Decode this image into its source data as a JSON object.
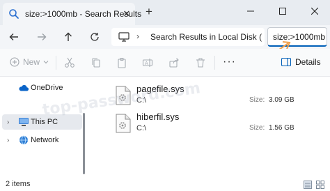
{
  "window": {
    "tab_title": "size:>1000mb - Search Results",
    "tab_icon": "search-icon",
    "new_tab_symbol": "+",
    "close_tab_symbol": "✕"
  },
  "address": {
    "path": "Search Results in Local Disk (",
    "search_value": "size:>1000mb"
  },
  "commands": {
    "new_label": "New",
    "details_label": "Details",
    "more_symbol": "···"
  },
  "sidebar": {
    "items": [
      {
        "label": "OneDrive",
        "icon": "cloud-icon"
      },
      {
        "label": "This PC",
        "icon": "computer-icon"
      },
      {
        "label": "Network",
        "icon": "network-icon"
      }
    ]
  },
  "files": [
    {
      "name": "pagefile.sys",
      "location": "C:\\",
      "size_label": "Size:",
      "size": "3.09 GB"
    },
    {
      "name": "hiberfil.sys",
      "location": "C:\\",
      "size_label": "Size:",
      "size": "1.56 GB"
    }
  ],
  "watermark": "top-password.com",
  "status": {
    "item_count": "2 items"
  },
  "colors": {
    "accent": "#005fb8",
    "annotation_arrow": "#f0a04b",
    "onedrive": "#0a64c8"
  }
}
